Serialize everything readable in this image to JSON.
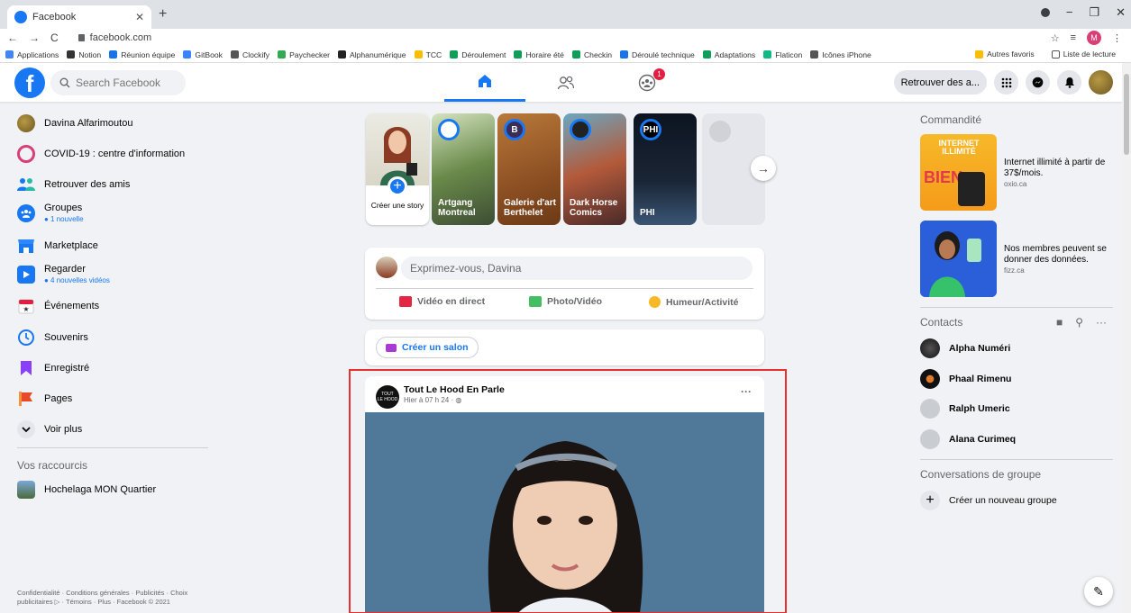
{
  "browser": {
    "tab_title": "Facebook",
    "url": "facebook.com",
    "bookmarks": [
      {
        "label": "Applications",
        "color": "#4285f4"
      },
      {
        "label": "Notion",
        "color": "#333333"
      },
      {
        "label": "Réunion équipe",
        "color": "#1a73e8"
      },
      {
        "label": "GitBook",
        "color": "#3884ff"
      },
      {
        "label": "Clockify",
        "color": "#555555"
      },
      {
        "label": "Paychecker",
        "color": "#34a853"
      },
      {
        "label": "Alphanumérique",
        "color": "#222222"
      },
      {
        "label": "TCC",
        "color": "#fbbc04"
      },
      {
        "label": "Déroulement",
        "color": "#0f9d58"
      },
      {
        "label": "Horaire été",
        "color": "#0f9d58"
      },
      {
        "label": "Checkin",
        "color": "#0f9d58"
      },
      {
        "label": "Déroulé technique",
        "color": "#1a73e8"
      },
      {
        "label": "Adaptations",
        "color": "#0f9d58"
      },
      {
        "label": "Flaticon",
        "color": "#12b886"
      },
      {
        "label": "Icônes iPhone",
        "color": "#555555"
      }
    ],
    "other_bookmarks": "Autres favoris",
    "reading_list": "Liste de lecture",
    "profile_initial": "M"
  },
  "header": {
    "search_placeholder": "Search Facebook",
    "notification_count": "1",
    "find_friends": "Retrouver des a..."
  },
  "sidebar": {
    "items": [
      {
        "label": "Davina Alfarimoutou",
        "sub": ""
      },
      {
        "label": "COVID-19 : centre d'information",
        "sub": ""
      },
      {
        "label": "Retrouver des amis",
        "sub": ""
      },
      {
        "label": "Groupes",
        "sub": "● 1 nouvelle"
      },
      {
        "label": "Marketplace",
        "sub": ""
      },
      {
        "label": "Regarder",
        "sub": "● 4 nouvelles vidéos"
      },
      {
        "label": "Événements",
        "sub": ""
      },
      {
        "label": "Souvenirs",
        "sub": ""
      },
      {
        "label": "Enregistré",
        "sub": ""
      },
      {
        "label": "Pages",
        "sub": ""
      },
      {
        "label": "Voir plus",
        "sub": ""
      }
    ],
    "shortcuts_title": "Vos raccourcis",
    "shortcut": "Hochelaga MON Quartier",
    "footer": "Confidentialité · Conditions générales · Publicités · Choix publicitaires ▷ · Témoins · Plus · Facebook © 2021"
  },
  "stories": {
    "create_label": "Créer une story",
    "items": [
      "Artgang Montreal",
      "Galerie d'art Berthelet",
      "Dark Horse Comics",
      "PHI"
    ]
  },
  "composer": {
    "placeholder": "Exprimez-vous, Davina",
    "live": "Vidéo en direct",
    "photo": "Photo/Vidéo",
    "feeling": "Humeur/Activité"
  },
  "room": {
    "label": "Créer un salon"
  },
  "post": {
    "author": "Tout Le Hood En Parle",
    "time": "Hier à 07 h 24 · ",
    "more": "···"
  },
  "right": {
    "sponsored_title": "Commandité",
    "ads": [
      {
        "title": "Internet illimité à partir de 37$/mois.",
        "source": "oxio.ca"
      },
      {
        "title": "Nos membres peuvent se donner des données.",
        "source": "fizz.ca"
      }
    ],
    "contacts_title": "Contacts",
    "contacts": [
      "Alpha Numéri",
      "Phaal Rimenu",
      "Ralph Umeric",
      "Alana Curimeq"
    ],
    "group_title": "Conversations de groupe",
    "new_group": "Créer un nouveau groupe"
  },
  "colors": {
    "fb_blue": "#1877f2",
    "highlight_red": "#e8302f",
    "notif_red": "#e41e3f"
  }
}
